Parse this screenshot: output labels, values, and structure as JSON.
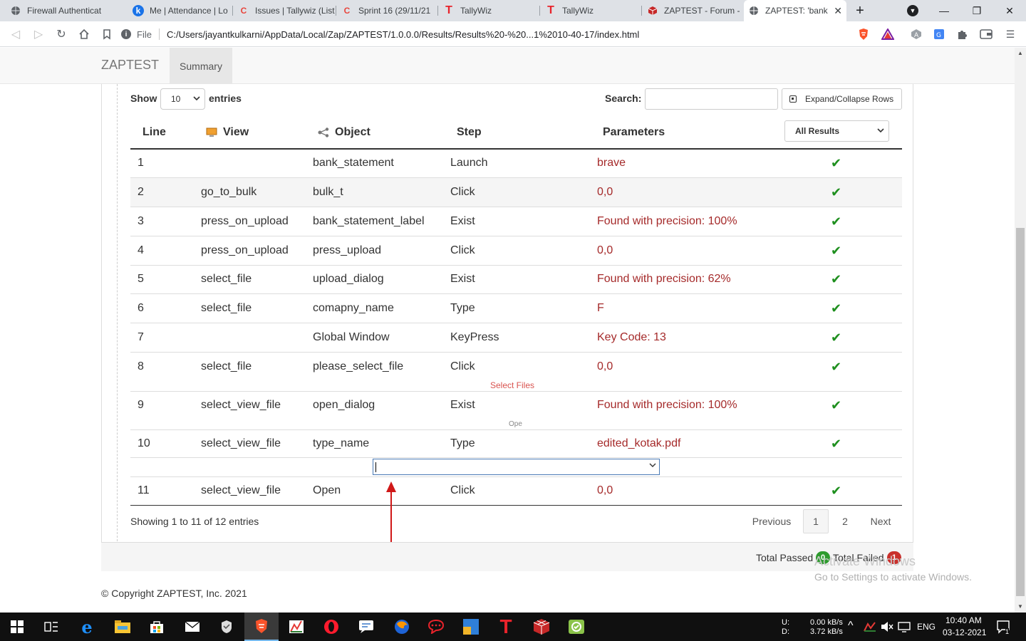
{
  "browser": {
    "tabs": [
      {
        "title": "Firewall Authenticat",
        "active": false
      },
      {
        "title": "Me | Attendance | Lo",
        "active": false
      },
      {
        "title": "Issues | Tallywiz (List)",
        "active": false
      },
      {
        "title": "Sprint 16 (29/11/21",
        "active": false
      },
      {
        "title": "TallyWiz",
        "active": false
      },
      {
        "title": "TallyWiz",
        "active": false
      },
      {
        "title": "ZAPTEST - Forum - I",
        "active": false
      },
      {
        "title": "ZAPTEST: 'bank",
        "active": true
      }
    ],
    "file_label": "File",
    "url": "C:/Users/jayantkulkarni/AppData/Local/Zap/ZAPTEST/1.0.0.0/Results/Results%20-%20...1%2010-40-17/index.html"
  },
  "nav": {
    "brand": "ZAPTEST",
    "summary_tab": "Summary"
  },
  "controls": {
    "show_label": "Show",
    "page_size": "10",
    "entries_label": "entries",
    "search_label": "Search:",
    "search_value": "",
    "expand_label": "Expand/Collapse Rows",
    "filter_value": "All Results"
  },
  "table": {
    "headers": {
      "line": "Line",
      "view": "View",
      "object": "Object",
      "step": "Step",
      "parameters": "Parameters"
    },
    "rows": [
      {
        "line": "1",
        "view": "",
        "object": "bank_statement",
        "step": "Launch",
        "parameters": "brave"
      },
      {
        "line": "2",
        "view": "go_to_bulk",
        "object": "bulk_t",
        "step": "Click",
        "parameters": "0,0"
      },
      {
        "line": "3",
        "view": "press_on_upload",
        "object": "bank_statement_label",
        "step": "Exist",
        "parameters": "Found with precision: 100%"
      },
      {
        "line": "4",
        "view": "press_on_upload",
        "object": "press_upload",
        "step": "Click",
        "parameters": "0,0"
      },
      {
        "line": "5",
        "view": "select_file",
        "object": "upload_dialog",
        "step": "Exist",
        "parameters": "Found with precision: 62%"
      },
      {
        "line": "6",
        "view": "select_file",
        "object": "comapny_name",
        "step": "Type",
        "parameters": "F"
      },
      {
        "line": "7",
        "view": "",
        "object": "Global Window",
        "step": "KeyPress",
        "parameters": "Key Code: 13"
      },
      {
        "line": "8",
        "view": "select_file",
        "object": "please_select_file",
        "step": "Click",
        "parameters": "0,0"
      },
      {
        "line": "9",
        "view": "select_view_file",
        "object": "open_dialog",
        "step": "Exist",
        "parameters": "Found with precision: 100%"
      },
      {
        "line": "10",
        "view": "select_view_file",
        "object": "type_name",
        "step": "Type",
        "parameters": "edited_kotak.pdf"
      },
      {
        "line": "11",
        "view": "select_view_file",
        "object": "Open",
        "step": "Click",
        "parameters": "0,0"
      }
    ],
    "result_mark": "✔",
    "sub_select_files": "Select Files",
    "sub_ope": "Ope"
  },
  "pagination": {
    "info": "Showing 1 to 11 of 12 entries",
    "previous": "Previous",
    "page1": "1",
    "page2": "2",
    "next": "Next"
  },
  "footer": {
    "total_passed_label": "Total Passed",
    "total_passed": "0",
    "total_failed_label": "Total Failed",
    "total_failed": "1",
    "watermark_title": "Activate Windows",
    "watermark_sub": "Go to Settings to activate Windows.",
    "copyright": "© Copyright ZAPTEST, Inc. 2021"
  },
  "taskbar": {
    "net_up_label": "U:",
    "net_down_label": "D:",
    "net_up": "0.00 kB/s",
    "net_down": "3.72 kB/s",
    "lang": "ENG",
    "time": "10:40 AM",
    "date": "03-12-2021",
    "notif_count": "1"
  },
  "colors": {
    "param_text": "#a52a2a",
    "ok_check": "#1e8f1e",
    "passed_badge": "#2e9b2e",
    "failed_badge": "#c9302c",
    "annotation_arrow": "#d01818"
  }
}
